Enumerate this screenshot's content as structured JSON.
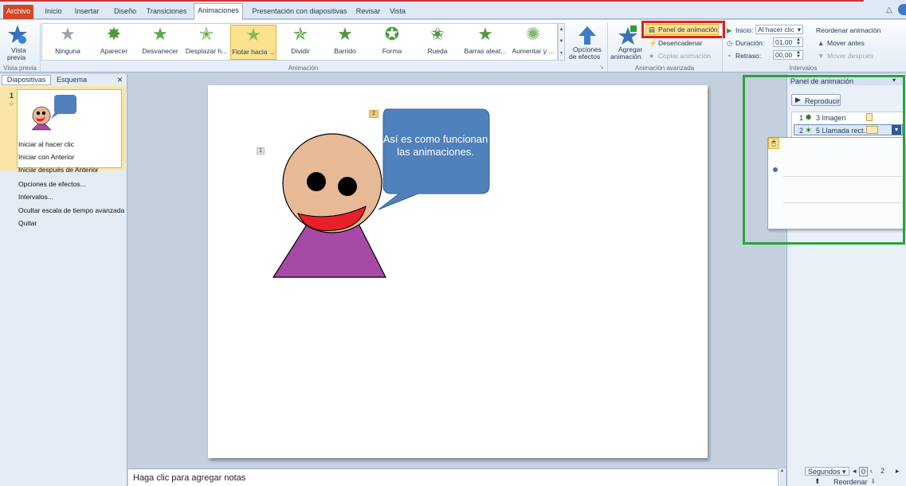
{
  "tabs": [
    "Archivo",
    "Inicio",
    "Insertar",
    "Diseño",
    "Transiciones",
    "Animaciones",
    "Presentación con diapositivas",
    "Revisar",
    "Vista"
  ],
  "preview": {
    "label1": "Vista",
    "label2": "previa",
    "group": "Vista previa"
  },
  "gallery": {
    "items": [
      "Ninguna",
      "Aparecer",
      "Desvanecer",
      "Desplazar h...",
      "Flotar hacia ...",
      "Dividir",
      "Barrido",
      "Forma",
      "Rueda",
      "Barras aleat...",
      "Aumentar y ..."
    ],
    "group": "Animación"
  },
  "effect_options": {
    "label1": "Opciones",
    "label2": "de efectos"
  },
  "advanced": {
    "add1": "Agregar",
    "add2": "animación",
    "panel": "Panel de animación",
    "trigger": "Desencadenar",
    "copy": "Copiar animación",
    "group": "Animación avanzada"
  },
  "timing": {
    "start_label": "Inicio:",
    "start_value": "Al hacer clic",
    "duration_label": "Duración:",
    "duration_value": "01,00",
    "delay_label": "Retraso:",
    "delay_value": "00,00",
    "reorder_title": "Reordenar animación",
    "move_earlier": "Mover antes",
    "move_later": "Mover después",
    "group": "Intervalos"
  },
  "left_pane": {
    "tab1": "Diapositivas",
    "tab2": "Esquema",
    "slide_number": "1",
    "close": "×"
  },
  "slide": {
    "tag1": "1",
    "tag2": "2",
    "bubble": "Así es como funcionan las animaciones."
  },
  "notes_placeholder": "Haga clic para agregar notas",
  "anim_pane": {
    "title": "Panel de animación",
    "play": "Reproducir",
    "items": [
      {
        "num": "1",
        "name": "3 Imagen"
      },
      {
        "num": "2",
        "name": "5 Llamada rect..."
      }
    ],
    "seconds": "Segundos",
    "t0": "0",
    "t2": "2",
    "reorder": "Reordenar"
  },
  "context_menu": [
    "Iniciar al hacer clic",
    "Iniciar con Anterior",
    "Iniciar después de Anterior",
    "Opciones de efectos...",
    "Intervalos...",
    "Ocultar escala de tiempo avanzada",
    "Quitar"
  ],
  "colors": {
    "highlight_red": "#e02020",
    "highlight_green": "#2aa33a",
    "face": "#e7b996",
    "shirt": "#a64aa6",
    "bubble": "#4f81bd",
    "tongue": "#e8202a"
  }
}
